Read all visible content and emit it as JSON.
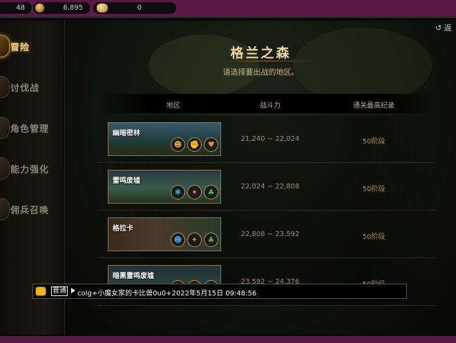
{
  "resources": {
    "level": "48",
    "gold": "6,895",
    "cera": "0"
  },
  "sidebar": {
    "items": [
      {
        "label": "冒险",
        "active": true
      },
      {
        "label": "讨伐战",
        "active": false
      },
      {
        "label": "角色管理",
        "active": false
      },
      {
        "label": "能力强化",
        "active": false
      },
      {
        "label": "佣兵召唤",
        "active": false
      }
    ]
  },
  "header": {
    "back_label": "↺ 返",
    "title": "格兰之森",
    "subtitle": "请选择要出战的地区。"
  },
  "table": {
    "headers": {
      "region": "地区",
      "power": "战斗力",
      "record": "通关最高纪录"
    },
    "rows": [
      {
        "name": "幽暗密林",
        "power": "21,240 ~ 22,024",
        "record": "50阶段",
        "icons": [
          "monster-face-icon",
          "fist-icon",
          "heart-icon"
        ]
      },
      {
        "name": "雷鸣废墟",
        "power": "22,024 ~ 22,808",
        "record": "50阶段",
        "icons": [
          "blue-creature-icon",
          "fire-spark-icon",
          "clover-icon"
        ]
      },
      {
        "name": "格拉卡",
        "power": "22,808 ~ 23,592",
        "record": "50阶段",
        "icons": [
          "blue-mask-icon",
          "fire-spark-icon",
          "clover-icon"
        ]
      },
      {
        "name": "暗黑雷鸣废墟",
        "power": "23,592 ~ 24,376",
        "record": "50阶段",
        "icons": [
          "blue-creature-icon",
          "clover-icon",
          "clover-icon"
        ]
      }
    ]
  },
  "chat": {
    "channel": "普通",
    "message": "colg+小魔女家的卡比兽0u0+2022年5月15日 09:48:56"
  },
  "colors": {
    "frame_purple": "#5b1947",
    "title_gold": "#f0d9a0",
    "value_text": "#a38a5c"
  }
}
